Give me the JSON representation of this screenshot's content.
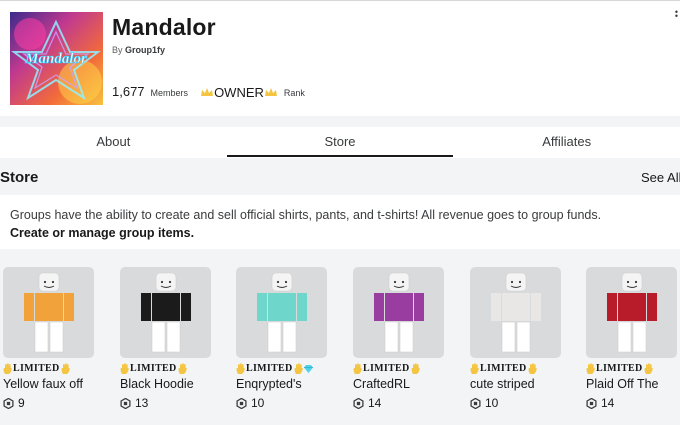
{
  "group": {
    "name": "Mandalor",
    "by_prefix": "By",
    "owner_name": "Group1fy",
    "members_count": "1,677",
    "members_label": "Members",
    "rank": "OWNER",
    "rank_label": "Rank",
    "icon_text": "Mandalor"
  },
  "tabs": [
    {
      "label": "About",
      "active": false
    },
    {
      "label": "Store",
      "active": true
    },
    {
      "label": "Affiliates",
      "active": false
    }
  ],
  "store": {
    "heading": "Store",
    "see_all": "See All",
    "description": "Groups have the ability to create and sell official shirts, pants, and t-shirts! All revenue goes to group funds.",
    "manage_link": "Create or manage group items."
  },
  "items": [
    {
      "badge": "LIMITED",
      "name": "Yellow faux off",
      "price": "9",
      "shirt_color": "#f2a23a",
      "pants_color": "#ffffff",
      "has_diamond": false
    },
    {
      "badge": "LIMITED",
      "name": "Black Hoodie",
      "price": "13",
      "shirt_color": "#1b1b1b",
      "pants_color": "#ffffff",
      "has_diamond": false
    },
    {
      "badge": "LIMITED",
      "name": "Enqrypted's",
      "price": "10",
      "shirt_color": "#6fd6cc",
      "pants_color": "#ffffff",
      "has_diamond": true
    },
    {
      "badge": "LIMITED",
      "name": "CraftedRL",
      "price": "14",
      "shirt_color": "#9a3da0",
      "pants_color": "#ffffff",
      "has_diamond": false
    },
    {
      "badge": "LIMITED",
      "name": "cute striped",
      "price": "10",
      "shirt_color": "#e9e6e6",
      "pants_color": "#ffffff",
      "has_diamond": false
    },
    {
      "badge": "LIMITED",
      "name": "Plaid Off The",
      "price": "14",
      "shirt_color": "#b81c2b",
      "pants_color": "#ffffff",
      "has_diamond": false
    }
  ],
  "colors": {
    "page_bg": "#f2f4f5",
    "panel_bg": "#ffffff",
    "thumb_bg": "#d9dadb",
    "text_dark": "#191919",
    "crown_gold": "#f4c542",
    "tab_underline": "#191919"
  }
}
